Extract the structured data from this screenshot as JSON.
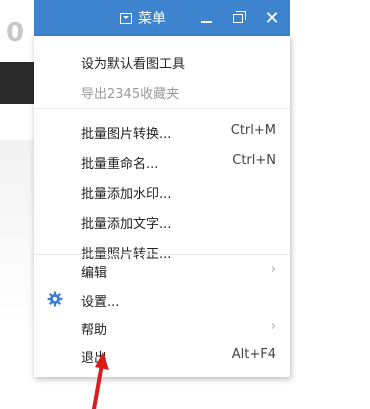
{
  "titlebar": {
    "menu_label": "菜单",
    "close_glyph": "✕"
  },
  "menu": {
    "group1": [
      {
        "label": "设为默认看图工具",
        "disabled": false
      },
      {
        "label": "导出2345收藏夹",
        "disabled": true
      }
    ],
    "group2": [
      {
        "label": "批量图片转换...",
        "shortcut": "Ctrl+M"
      },
      {
        "label": "批量重命名...",
        "shortcut": "Ctrl+N"
      },
      {
        "label": "批量添加水印...",
        "shortcut": ""
      },
      {
        "label": "批量添加文字...",
        "shortcut": ""
      },
      {
        "label": "批量照片转正...",
        "shortcut": ""
      }
    ],
    "group3": [
      {
        "label": "编辑",
        "submenu": true
      },
      {
        "label": "设置...",
        "icon": "gear-icon"
      },
      {
        "label": "帮助",
        "submenu": true
      },
      {
        "label": "退出",
        "shortcut": "Alt+F4"
      }
    ]
  },
  "colors": {
    "titlebar": "#3d83ce",
    "gear": "#3d7fd1",
    "arrow": "#d91c1c"
  }
}
